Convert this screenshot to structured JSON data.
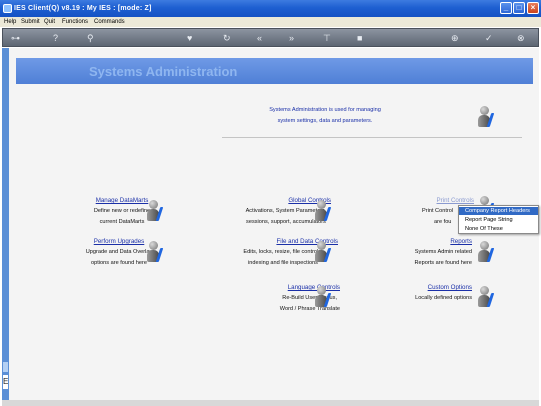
{
  "window": {
    "title": "IES Client(Q) v8.19 : My IES :      [mode: Z]"
  },
  "menu": [
    "Help",
    "Submit",
    "Quit",
    "Functions",
    "Commands"
  ],
  "toolbar_icons": [
    "key-icon",
    "help-icon",
    "search-icon",
    "heart-icon",
    "refresh-icon",
    "back-icon",
    "forward-icon",
    "filter-icon",
    "stop-icon",
    "add-icon",
    "confirm-icon",
    "close-icon"
  ],
  "page": {
    "title": "Systems Administration",
    "intro_line1": "Systems Administration is used for managing",
    "intro_line2": "system settings, data and parameters."
  },
  "sections": {
    "manage_datamarts": {
      "title": "Manage DataMarts",
      "line1": "Define new or redefine",
      "line2": "current DataMarts"
    },
    "perform_upgrades": {
      "title": "Perform Upgrades",
      "line1": "Upgrade and Data Overlay",
      "line2": "options are found here"
    },
    "global_controls": {
      "title": "Global Controls",
      "line1": "Activations, System Parameters,",
      "line2": "sessions, support, accumulators"
    },
    "file_data_controls": {
      "title": "File and Data Controls",
      "line1": "Edits, locks, resize, file controls,",
      "line2": "indexing and file inspections"
    },
    "language_controls": {
      "title": "Language Controls",
      "line1": "Re-Build User Menus,",
      "line2": "Word / Phrase Translate"
    },
    "print_controls": {
      "title": "Print Controls",
      "line1": "Print Control",
      "line2": "are fou"
    },
    "reports": {
      "title": "Reports",
      "line1": "Systems Admin related",
      "line2": "Reports are found here"
    },
    "custom_options": {
      "title": "Custom Options",
      "line1": "Locally defined options"
    }
  },
  "context_menu": {
    "items": [
      "Company Report Headers",
      "Report Page String",
      "None Of These"
    ],
    "selected_index": 0
  },
  "colors": {
    "titlebar": "#1e5fd1",
    "banner": "#5b88dc",
    "link": "#1a2fa8",
    "selection": "#316ac5"
  }
}
